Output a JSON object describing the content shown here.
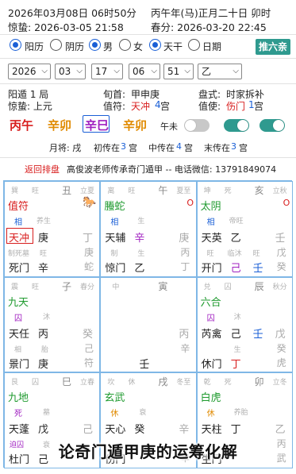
{
  "header": {
    "solar_datetime": "2026年03月08日 06时50分",
    "lunar_datetime": "丙午年(马)正月二十日 卯时",
    "jingzhe_label": "惊蛰: 2026-03-05 21:58",
    "chunfen_label": "春分: 2026-03-20 22:45"
  },
  "options": {
    "calendar_solar": "阳历",
    "calendar_lunar": "阴历",
    "gender_male": "男",
    "gender_female": "女",
    "mode_tianpan": "天干",
    "mode_day": "日期",
    "paipan_button": "推六亲"
  },
  "selectors": {
    "year": "2026",
    "month": "03",
    "day": "17",
    "hour": "06",
    "minute": "51",
    "stem": "乙"
  },
  "pan_info": {
    "ju": "阳遁 1 局",
    "jieqi": "惊蛰: 上元",
    "xunshou_label": "旬首:",
    "xunshou_value": "甲申庚",
    "zhifu_label": "值符:",
    "zhifu_star": "天冲",
    "zhifu_palace_pre": " ",
    "zhifu_palace_num": "4",
    "zhifu_palace_suf": " 宫",
    "pan_style_label": "盘式:",
    "pan_style_value": "时家拆补",
    "zhishi_label": "值使:",
    "zhishi_door": "伤门",
    "zhishi_palace_num": "1",
    "zhishi_palace_suf": " 宫"
  },
  "pillars": {
    "year": "丙午",
    "month": "辛卯",
    "day": "辛巳",
    "hour": "辛卯",
    "wuwei_label": "午未"
  },
  "chu_row": {
    "yuejiang": "月将:  戌",
    "chu_pre": "初传在",
    "chu_num": "3",
    "chu_suf": "宫",
    "zhong_pre": "中传在",
    "zhong_num": "4",
    "zhong_suf": "宫",
    "mo_pre": "末传在",
    "mo_num": "3",
    "mo_suf": "宫"
  },
  "banner": {
    "back_label": "返回排盘",
    "text": "高俊波老师传承奇门遁甲 -- 电话微信: 13791849074"
  },
  "palaces": {
    "p4": {
      "r1": [
        "巽",
        "旺",
        "丑",
        "立夏"
      ],
      "deity": "值符",
      "horse": "马",
      "zhang": "相",
      "zhang2": "养生",
      "star": "天冲",
      "heaven_stem": "庚",
      "earth_stem": "丁",
      "mid_small": [
        "制死墓",
        "旺",
        "",
        "庚"
      ],
      "door": "死门",
      "door_stem": "辛",
      "br": "蛇"
    },
    "p9": {
      "r1": [
        "离",
        "旺",
        "午",
        "夏至"
      ],
      "deity": "螣蛇",
      "kong": "O",
      "zhang": "相",
      "zhang2": "生",
      "star": "天辅",
      "heaven_stem": "辛",
      "earth_stem": "庚",
      "mid_small": [
        "制",
        "生",
        "",
        "丙"
      ],
      "door": "惊门",
      "door_stem": "乙",
      "br": "丁"
    },
    "p2": {
      "r1": [
        "坤",
        "死",
        "亥",
        "立秋"
      ],
      "deity": "太阴",
      "kong": "O",
      "zhang": "相",
      "zhang2": "帝旺",
      "star": "天英",
      "heaven_stem": "乙",
      "earth_stem": "壬",
      "mid_small": [
        "旺",
        "临沐",
        "旺",
        "戊"
      ],
      "door": "开门",
      "door_stem": "己",
      "door_stem2": "壬",
      "br": "癸"
    },
    "p3": {
      "r1": [
        "震",
        "旺",
        "子",
        "春分"
      ],
      "deity": "九天",
      "zhang": "囚",
      "zhang2": "沐",
      "star": "天任",
      "heaven_stem": "丙",
      "earth_stem": "癸",
      "mid_small": [
        "相",
        "胎",
        "",
        "己"
      ],
      "door": "景门",
      "door_stem": "庚",
      "br": "符"
    },
    "p5": {
      "r1": [
        "中",
        "",
        "寅",
        ""
      ],
      "earth_stem": "丙",
      "small_earth": "辛",
      "bottom": "壬"
    },
    "p7": {
      "r1": [
        "兑",
        "囚",
        "辰",
        "秋分"
      ],
      "deity": "六合",
      "zhang": "囚",
      "zhang2": "沐",
      "star": "芮禽",
      "heaven_stem": "己",
      "heaven_stem2": "壬",
      "earth_stem": "戊",
      "mid_small": [
        "生",
        "",
        "",
        "癸"
      ],
      "door": "休门",
      "door_stem": "丁",
      "br": "虎"
    },
    "p8": {
      "r1": [
        "艮",
        "囚",
        "巳",
        "立春"
      ],
      "deity": "九地",
      "zhang": "死",
      "zhang2": "墓",
      "star": "天蓬",
      "heaven_stem": "戊",
      "earth_stem": "己",
      "mid_small": [
        "迫囚",
        "衰",
        "",
        ""
      ],
      "door": "杜门",
      "door_stem": "己",
      "br": ""
    },
    "p1": {
      "r1": [
        "坎",
        "休",
        "戌",
        "冬至"
      ],
      "deity": "玄武",
      "zhang": "休",
      "zhang2": "衰",
      "star": "天心",
      "heaven_stem": "癸",
      "earth_stem": "辛",
      "mid_small": [
        "",
        "",
        "",
        ""
      ],
      "door": "伤门",
      "door_stem": "",
      "br": "辛"
    },
    "p6": {
      "r1": [
        "乾",
        "死",
        "卯",
        "立冬"
      ],
      "deity": "白虎",
      "zhang": "休",
      "zhang2": "养胎",
      "star": "天柱",
      "heaven_stem": "丁",
      "earth_stem": "乙",
      "mid_small": [
        "",
        "",
        "",
        "丙"
      ],
      "door": "生门",
      "door_stem": "",
      "br": "武"
    }
  },
  "overlay_caption": "论奇门遁甲庚的运筹化解",
  "colors": {
    "accent_teal": "#2f9a8f",
    "red": "#d81e1e",
    "green": "#1e9a2e",
    "blue": "#1a5fd6",
    "purple": "#a020c0",
    "orange": "#e08a00"
  }
}
